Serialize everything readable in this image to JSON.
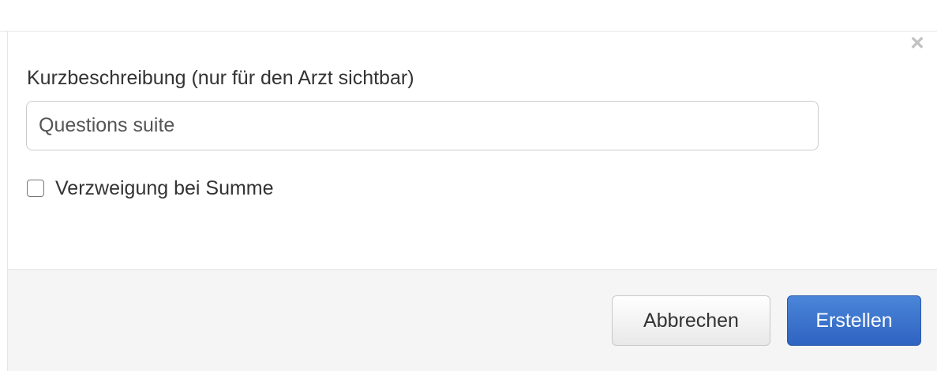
{
  "dialog": {
    "close_symbol": "×",
    "field_label": "Kurzbeschreibung (nur für den Arzt sichtbar)",
    "input_value": "Questions suite",
    "checkbox_label": "Verzweigung bei Summe",
    "checkbox_checked": false,
    "cancel_label": "Abbrechen",
    "create_label": "Erstellen"
  },
  "colors": {
    "primary_button": "#2f63c1",
    "footer_background": "#f5f5f5",
    "close_icon": "#c2c2c2"
  }
}
